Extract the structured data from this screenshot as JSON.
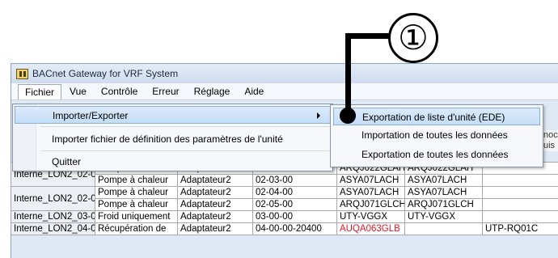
{
  "window": {
    "title": "BACnet Gateway for VRF System"
  },
  "callout": {
    "number": "①"
  },
  "menubar": [
    "Fichier",
    "Vue",
    "Contrôle",
    "Erreur",
    "Réglage",
    "Aide"
  ],
  "file_menu": {
    "items": [
      {
        "label": "Importer/Exporter",
        "has_submenu": true,
        "highlighted": true
      },
      {
        "label": "Importer fichier de définition des paramètres de l'unité"
      },
      {
        "label": "Quitter"
      }
    ]
  },
  "submenu": {
    "items": [
      {
        "label": "Exportation de liste d'unité (EDE)",
        "highlighted": true
      },
      {
        "label": "Importation de toutes les données"
      },
      {
        "label": "Exportation de toutes les données"
      }
    ]
  },
  "grid": {
    "peek": [
      "noc",
      "uis"
    ],
    "rows": [
      [
        "Interne_LON2_02-02",
        "Pompe à chaleur",
        "Adaptateur2",
        "02-02-00",
        "ARQJ022GLAH",
        "ARQJ022GLAH",
        ""
      ],
      [
        "",
        "Pompe à chaleur",
        "Adaptateur2",
        "02-03-00",
        "ASYA07LACH",
        "ASYA07LACH",
        ""
      ],
      [
        "Interne_LON2_02-04",
        "Pompe à chaleur",
        "Adaptateur2",
        "02-04-00",
        "ASYA07LACH",
        "ASYA07LACH",
        ""
      ],
      [
        "",
        "Pompe à chaleur",
        "Adaptateur2",
        "02-05-00",
        "ARQJ071GLCH",
        "ARQJ071GLCH",
        ""
      ],
      [
        "Interne_LON2_03-00",
        "Froid uniquement",
        "Adaptateur2",
        "03-00-00",
        "UTY-VGGX",
        "UTY-VGGX",
        ""
      ],
      [
        "Interne_LON2_04-00",
        "Récupération de",
        "Adaptateur2",
        "04-00-00-20400",
        "AUQA063GLB",
        "",
        "UTP-RQ01C"
      ]
    ]
  },
  "colors": {
    "highlight": "#c4ddf7",
    "error_text": "#e0172a"
  }
}
